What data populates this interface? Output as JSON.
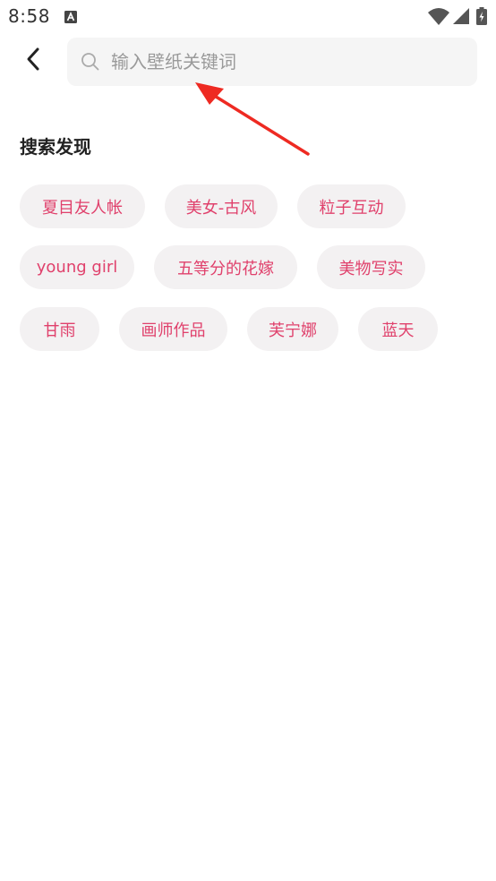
{
  "status_bar": {
    "time": "8:58",
    "notification_icon": "text-a-icon",
    "wifi_icon": "wifi-icon",
    "signal_icon": "signal-icon",
    "battery_icon": "battery-charging-icon"
  },
  "header": {
    "back_icon": "chevron-left-icon",
    "search_icon": "search-icon",
    "search_placeholder": "输入壁纸关键词",
    "search_value": ""
  },
  "discover": {
    "title": "搜索发现",
    "tags": [
      "夏目友人帐",
      "美女-古风",
      "粒子互动",
      "young girl",
      "五等分的花嫁",
      "美物写实",
      "甘雨",
      "画师作品",
      "芙宁娜",
      "蓝天"
    ]
  },
  "colors": {
    "tag_text": "#e0416c",
    "tag_bg": "#f3f1f2",
    "search_bg": "#f5f5f5",
    "annotation_arrow": "#ee2a22"
  }
}
